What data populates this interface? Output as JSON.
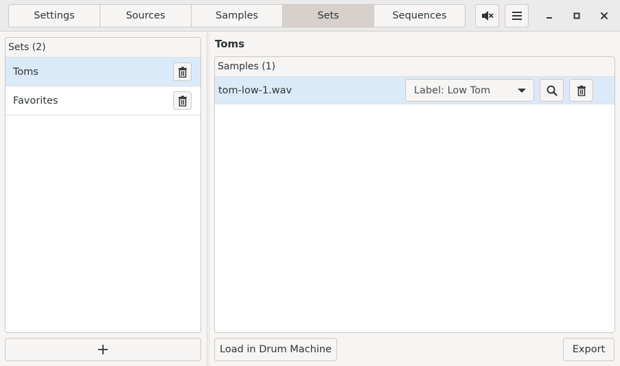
{
  "header": {
    "tabs": [
      {
        "label": "Settings"
      },
      {
        "label": "Sources"
      },
      {
        "label": "Samples"
      },
      {
        "label": "Sets"
      },
      {
        "label": "Sequences"
      }
    ],
    "active_tab": "Sets",
    "mute_icon": "speaker-muted-icon",
    "menu_icon": "hamburger-menu-icon",
    "window_controls": [
      "minimize-icon",
      "maximize-icon",
      "close-icon"
    ]
  },
  "sets_panel": {
    "header": "Sets (2)",
    "items": [
      {
        "label": "Toms",
        "selected": true
      },
      {
        "label": "Favorites",
        "selected": false
      }
    ],
    "add_icon": "plus-icon"
  },
  "detail": {
    "title": "Toms",
    "samples_header": "Samples (1)",
    "samples": [
      {
        "filename": "tom-low-1.wav",
        "label_value": "Label: Low Tom"
      }
    ],
    "load_button": "Load in Drum Machine",
    "export_button": "Export"
  },
  "colors": {
    "selection": "#dbeaf9",
    "active_tab": "#d6d1cd",
    "background": "#f6f5f4"
  }
}
